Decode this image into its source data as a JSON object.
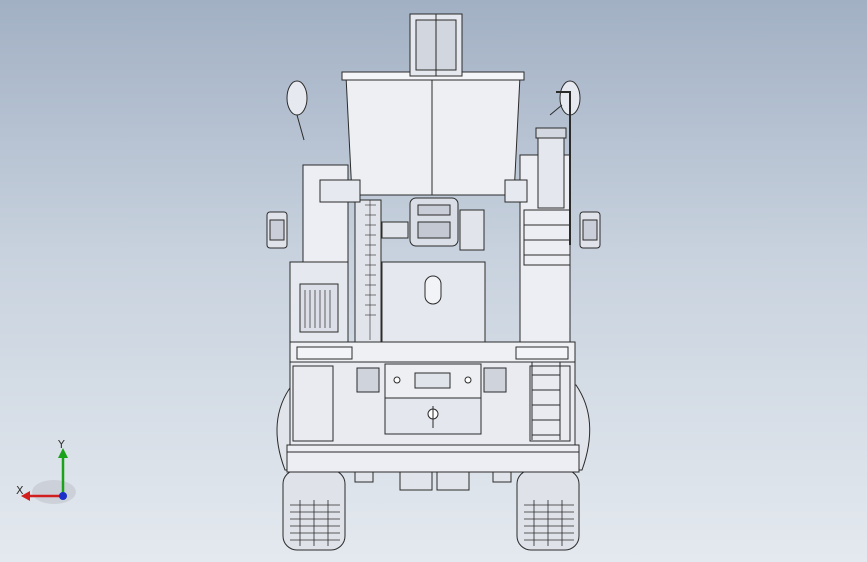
{
  "window": {
    "title": ""
  },
  "viewport": {
    "view": "front",
    "model": "mixer-truck-front-view",
    "background": {
      "top": "#a2b0c4",
      "bottom": "#e4e9ef"
    },
    "line_color": "#2b2b2b",
    "body_fill": "#e9ebf1",
    "shade_fill": "#d2d6df"
  },
  "triad": {
    "x_label": "X",
    "y_label": "Y",
    "x_color": "#d11f1f",
    "y_color": "#1aa31a",
    "z_color": "#1c2fc9"
  }
}
